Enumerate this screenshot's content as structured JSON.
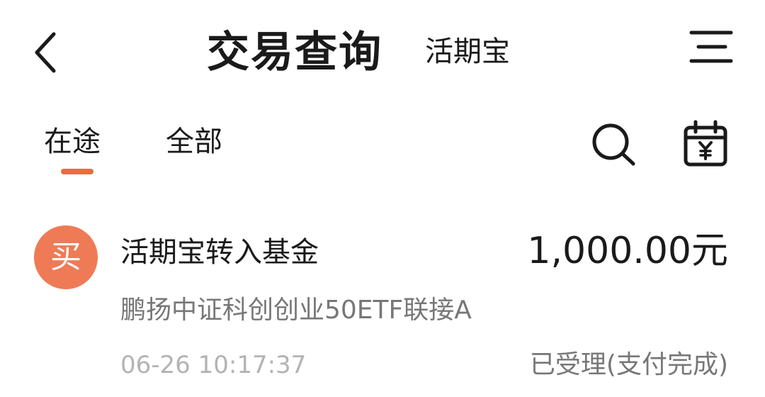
{
  "header": {
    "title": "交易查询",
    "subtitle": "活期宝"
  },
  "tabs": [
    {
      "label": "在途",
      "active": true
    },
    {
      "label": "全部",
      "active": false
    }
  ],
  "icons": {
    "back": "chevron-left-icon",
    "menu": "menu-icon",
    "search": "search-icon",
    "calendar": "calendar-yen-icon"
  },
  "records": [
    {
      "badge": "买",
      "title": "活期宝转入基金",
      "amount": "1,000.00元",
      "fund_name": "鹏扬中证科创创业50ETF联接A",
      "time": "06-26 10:17:37",
      "status": "已受理(支付完成)"
    }
  ],
  "colors": {
    "accent": "#ee6b3b",
    "badge": "#ee7b55",
    "primary_text": "#1a1a1a",
    "secondary_text": "#777777",
    "muted_text": "#b3b3b3"
  }
}
